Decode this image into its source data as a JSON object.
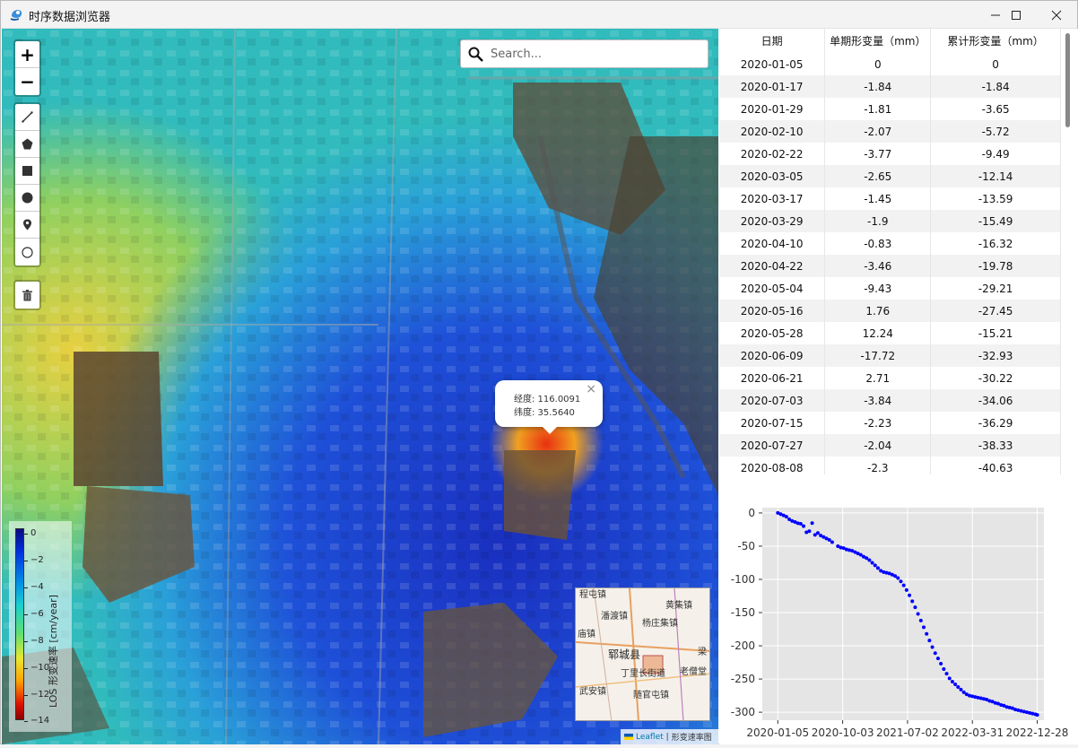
{
  "window": {
    "title": "时序数据浏览器",
    "controls": [
      "minimize-icon",
      "maximize-icon",
      "close-icon"
    ]
  },
  "map": {
    "search_placeholder": "Search...",
    "zoom_in": "+",
    "zoom_out": "−",
    "draw_tools": [
      "polyline-icon",
      "polygon-icon",
      "rectangle-icon",
      "circle-icon",
      "marker-icon",
      "circlemarker-icon"
    ],
    "popup": {
      "lon_label": "经度: 116.0091",
      "lat_label": "纬度: 35.5640",
      "close": "×"
    },
    "legend": {
      "label": "LOS 形变速率 [cm/year]",
      "ticks": [
        "0",
        "−2",
        "−4",
        "−6",
        "−8",
        "−10",
        "−12",
        "−14"
      ]
    },
    "minimap_places": [
      "程屯镇",
      "潘渡镇",
      "杨庄集镇",
      "黄集镇",
      "庙镇",
      "郓城县",
      "丁里长街道",
      "老僧堂",
      "武安镇",
      "随官屯镇",
      "梁",
      "程屯镇"
    ],
    "attribution": {
      "leaflet": "Leaflet",
      "layer": "形变速率图"
    }
  },
  "table": {
    "headers": [
      "日期",
      "单期形变量（mm）",
      "累计形变量（mm）"
    ],
    "rows": [
      [
        "2020-01-05",
        "0",
        "0"
      ],
      [
        "2020-01-17",
        "-1.84",
        "-1.84"
      ],
      [
        "2020-01-29",
        "-1.81",
        "-3.65"
      ],
      [
        "2020-02-10",
        "-2.07",
        "-5.72"
      ],
      [
        "2020-02-22",
        "-3.77",
        "-9.49"
      ],
      [
        "2020-03-05",
        "-2.65",
        "-12.14"
      ],
      [
        "2020-03-17",
        "-1.45",
        "-13.59"
      ],
      [
        "2020-03-29",
        "-1.9",
        "-15.49"
      ],
      [
        "2020-04-10",
        "-0.83",
        "-16.32"
      ],
      [
        "2020-04-22",
        "-3.46",
        "-19.78"
      ],
      [
        "2020-05-04",
        "-9.43",
        "-29.21"
      ],
      [
        "2020-05-16",
        "1.76",
        "-27.45"
      ],
      [
        "2020-05-28",
        "12.24",
        "-15.21"
      ],
      [
        "2020-06-09",
        "-17.72",
        "-32.93"
      ],
      [
        "2020-06-21",
        "2.71",
        "-30.22"
      ],
      [
        "2020-07-03",
        "-3.84",
        "-34.06"
      ],
      [
        "2020-07-15",
        "-2.23",
        "-36.29"
      ],
      [
        "2020-07-27",
        "-2.04",
        "-38.33"
      ],
      [
        "2020-08-08",
        "-2.3",
        "-40.63"
      ]
    ]
  },
  "chart_data": {
    "type": "scatter",
    "title": "",
    "xlabel": "",
    "ylabel": "",
    "x_ticks": [
      "2020-01-05",
      "2020-10-03",
      "2021-07-02",
      "2022-03-31",
      "2022-12-28"
    ],
    "y_ticks": [
      0,
      -50,
      -100,
      -150,
      -200,
      -250,
      -300
    ],
    "xlim": [
      "2019-11-01",
      "2023-01-25"
    ],
    "ylim": [
      -312,
      8
    ],
    "grid": true,
    "color": "#0000ff",
    "x": [
      "2020-01-05",
      "2020-01-17",
      "2020-01-29",
      "2020-02-10",
      "2020-02-22",
      "2020-03-05",
      "2020-03-17",
      "2020-03-29",
      "2020-04-10",
      "2020-04-22",
      "2020-05-04",
      "2020-05-16",
      "2020-05-28",
      "2020-06-09",
      "2020-06-21",
      "2020-07-03",
      "2020-07-15",
      "2020-07-27",
      "2020-08-08",
      "2020-08-20",
      "2020-09-13",
      "2020-09-25",
      "2020-10-07",
      "2020-10-19",
      "2020-10-31",
      "2020-11-12",
      "2020-11-24",
      "2020-12-06",
      "2020-12-18",
      "2020-12-30",
      "2021-01-11",
      "2021-01-23",
      "2021-02-04",
      "2021-02-16",
      "2021-02-28",
      "2021-03-12",
      "2021-03-24",
      "2021-04-05",
      "2021-04-17",
      "2021-04-29",
      "2021-05-11",
      "2021-05-23",
      "2021-06-04",
      "2021-06-16",
      "2021-06-28",
      "2021-07-10",
      "2021-07-22",
      "2021-08-03",
      "2021-08-15",
      "2021-08-27",
      "2021-09-08",
      "2021-09-20",
      "2021-10-02",
      "2021-10-14",
      "2021-10-26",
      "2021-11-07",
      "2021-11-19",
      "2021-12-01",
      "2021-12-13",
      "2021-12-25",
      "2022-01-06",
      "2022-01-18",
      "2022-01-30",
      "2022-02-11",
      "2022-02-23",
      "2022-03-07",
      "2022-03-19",
      "2022-03-31",
      "2022-04-12",
      "2022-04-24",
      "2022-05-06",
      "2022-05-18",
      "2022-05-30",
      "2022-06-11",
      "2022-06-23",
      "2022-07-05",
      "2022-07-17",
      "2022-07-29",
      "2022-08-10",
      "2022-08-22",
      "2022-09-03",
      "2022-09-15",
      "2022-09-27",
      "2022-10-09",
      "2022-10-21",
      "2022-11-02",
      "2022-11-14",
      "2022-11-26",
      "2022-12-08",
      "2022-12-20",
      "2022-12-28"
    ],
    "y": [
      0,
      -1.84,
      -3.65,
      -5.72,
      -9.49,
      -12.14,
      -13.59,
      -15.49,
      -16.32,
      -19.78,
      -29.21,
      -27.45,
      -15.21,
      -32.93,
      -30.22,
      -34.06,
      -36.29,
      -38.33,
      -40.63,
      -44,
      -50,
      -52,
      -53,
      -55,
      -56,
      -57,
      -59,
      -61,
      -63,
      -66,
      -68,
      -71,
      -75,
      -79,
      -83,
      -87,
      -89,
      -90,
      -91,
      -93,
      -95,
      -98,
      -103,
      -109,
      -116,
      -124,
      -133,
      -142,
      -152,
      -162,
      -172,
      -182,
      -192,
      -202,
      -211,
      -219,
      -227,
      -235,
      -242,
      -249,
      -254,
      -258,
      -262,
      -266,
      -270,
      -273,
      -275,
      -276,
      -277,
      -278,
      -279,
      -280,
      -281,
      -283,
      -284,
      -286,
      -287,
      -289,
      -290,
      -292,
      -293,
      -294,
      -296,
      -297,
      -298,
      -299,
      -300,
      -301,
      -302,
      -303,
      -304
    ]
  }
}
